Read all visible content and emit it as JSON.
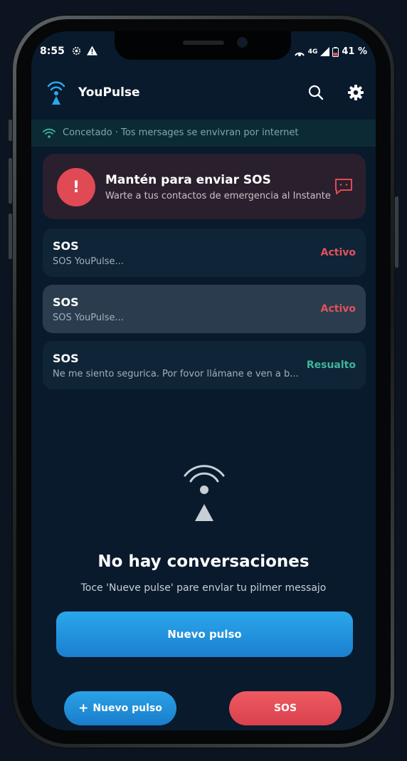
{
  "status_bar": {
    "time": "8:55",
    "network": "4G",
    "battery": "41 %"
  },
  "app": {
    "title": "YouPulse"
  },
  "banner": {
    "text": "Concetado · Tos mersages se envivran por internet"
  },
  "sos_card": {
    "badge": "!",
    "title": "Mantén para enviar SOS",
    "subtitle": "Warte a tus contactos de emergencia al Instante"
  },
  "conversations": [
    {
      "title": "SOS",
      "preview": "SOS YouPulse...",
      "status": "Activo",
      "status_color": "#e2515c"
    },
    {
      "title": "SOS",
      "preview": "SOS YouPulse...",
      "status": "Activo",
      "status_color": "#e2515c"
    },
    {
      "title": "SOS",
      "preview": "Ne me siento segurica. Por fovor llámane e ven a b...",
      "status": "Resualto",
      "status_color": "#3fb59a"
    }
  ],
  "empty_state": {
    "title": "No hay conversaciones",
    "subtitle": "Toce 'Nueve pulse' pare envlar tu pilmer messajo"
  },
  "buttons": {
    "primary": "Nuevo pulso",
    "fab_new_icon": "+",
    "fab_new": "Nuevo pulso",
    "fab_sos": "SOS"
  },
  "colors": {
    "accent_blue": "#1f8fdc",
    "sos_red": "#e04a55",
    "background": "#081a2c"
  },
  "icons": [
    "wifi-icon",
    "search-icon",
    "gear-icon",
    "message-icon",
    "pulse-beacon-icon"
  ]
}
